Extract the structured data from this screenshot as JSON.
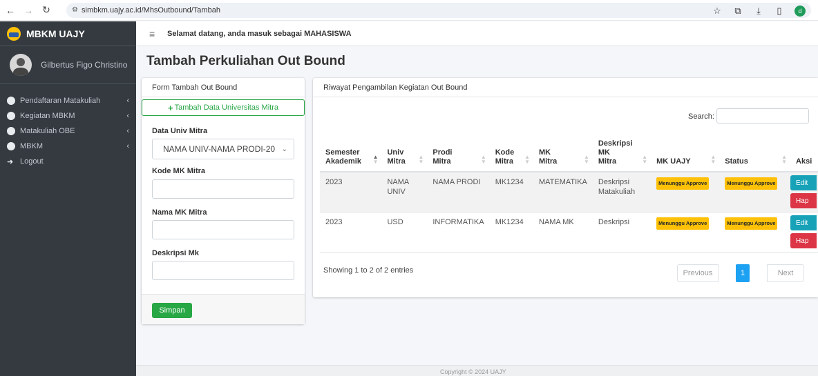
{
  "browser": {
    "url": "simbkm.uajy.ac.id/MhsOutbound/Tambah",
    "profile_initial": "d"
  },
  "sidebar": {
    "brand": "MBKM UAJY",
    "user_name": "Gilbertus Figo Christino",
    "items": [
      {
        "label": "Pendaftaran Matakuliah"
      },
      {
        "label": "Kegiatan MBKM"
      },
      {
        "label": "Matakuliah OBE"
      },
      {
        "label": "MBKM"
      },
      {
        "label": "Logout"
      }
    ]
  },
  "topnav": {
    "welcome": "Selamat datang, anda masuk sebagai MAHASISWA"
  },
  "page_title": "Tambah Perkuliahan Out Bound",
  "form": {
    "header": "Form Tambah Out Bound",
    "add_univ_label": "Tambah Data Universitas Mitra",
    "univ_label": "Data Univ Mitra",
    "univ_value": "NAMA UNIV-NAMA PRODI-20",
    "kode_label": "Kode MK Mitra",
    "kode_value": "",
    "nama_label": "Nama MK Mitra",
    "nama_value": "",
    "desk_label": "Deskripsi Mk",
    "desk_value": "",
    "save_label": "Simpan"
  },
  "table_card": {
    "header": "Riwayat Pengambilan Kegiatan Out Bound",
    "search_label": "Search:",
    "columns": [
      {
        "line1": "Semester",
        "line2": "Akademik"
      },
      {
        "line1": "Univ",
        "line2": "Mitra"
      },
      {
        "line1": "Prodi",
        "line2": "Mitra"
      },
      {
        "line1": "Kode",
        "line2": "Mitra"
      },
      {
        "line1": "MK",
        "line2": "Mitra"
      },
      {
        "line1": "Deskripsi",
        "line2": "MK",
        "line3": "Mitra"
      },
      {
        "line1": "MK UAJY"
      },
      {
        "line1": "Status"
      },
      {
        "line1": "Aksi"
      }
    ],
    "rows": [
      {
        "semester": "2023",
        "univ_a": "NAMA",
        "univ_b": "UNIV",
        "prodi": "NAMA PRODI",
        "kode": "MK1234",
        "mk": "MATEMATIKA",
        "desk_a": "Deskripsi",
        "desk_b": "Matakuliah",
        "mk_uajy": "Menunggu Approve",
        "status": "Menunggu Approve",
        "edit": "Edit",
        "hapus": "Hap"
      },
      {
        "semester": "2023",
        "univ_a": "USD",
        "univ_b": "",
        "prodi": "INFORMATIKA",
        "kode": "MK1234",
        "mk": "NAMA MK",
        "desk_a": "Deskripsi",
        "desk_b": "",
        "mk_uajy": "Menunggu Approve",
        "status": "Menunggu Approve",
        "edit": "Edit",
        "hapus": "Hap"
      }
    ],
    "info": "Showing 1 to 2 of 2 entries",
    "prev": "Previous",
    "page": "1",
    "next": "Next"
  },
  "footer": {
    "text": "Copyright © 2024 UAJY"
  }
}
